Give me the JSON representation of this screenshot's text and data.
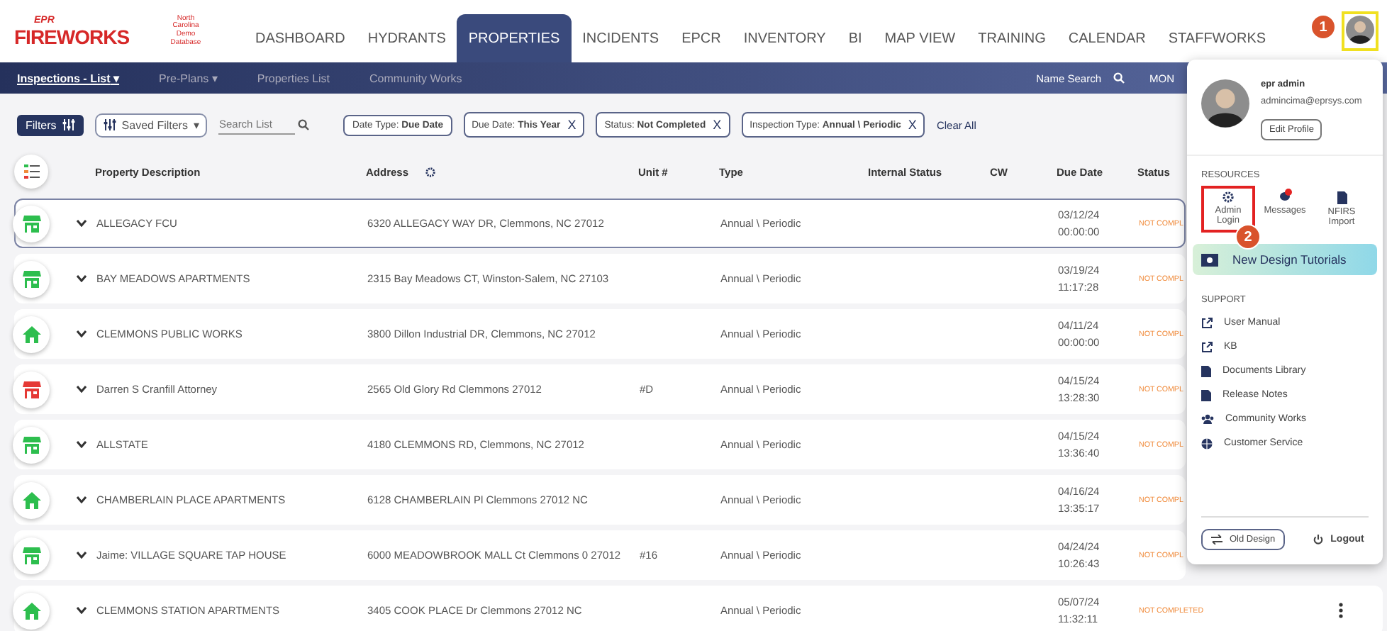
{
  "brand": {
    "logo_small": "EPR",
    "logo": "FIREWORKS",
    "database": "North Carolina Demo Database"
  },
  "main_nav": [
    {
      "label": "DASHBOARD",
      "selected": false
    },
    {
      "label": "HYDRANTS",
      "selected": false
    },
    {
      "label": "PROPERTIES",
      "selected": true
    },
    {
      "label": "INCIDENTS",
      "selected": false
    },
    {
      "label": "EPCR",
      "selected": false
    },
    {
      "label": "INVENTORY",
      "selected": false
    },
    {
      "label": "BI",
      "selected": false
    },
    {
      "label": "MAP VIEW",
      "selected": false
    },
    {
      "label": "TRAINING",
      "selected": false
    },
    {
      "label": "CALENDAR",
      "selected": false
    },
    {
      "label": "STAFFWORKS",
      "selected": false
    }
  ],
  "sub_nav": {
    "items": [
      {
        "label": "Inspections - List",
        "selected": true,
        "caret": "▾"
      },
      {
        "label": "Pre-Plans",
        "selected": false,
        "caret": "▾"
      },
      {
        "label": "Properties List",
        "selected": false
      },
      {
        "label": "Community Works",
        "selected": false
      }
    ],
    "name_search": "Name Search",
    "day": "MON"
  },
  "filters": {
    "button": "Filters",
    "saved": "Saved Filters",
    "saved_caret": "▾",
    "search_placeholder": "Search List",
    "chips": [
      {
        "name": "Date Type:",
        "value": "Due Date"
      },
      {
        "name": "Due Date:",
        "value": "This Year",
        "remove": "X"
      },
      {
        "name": "Status:",
        "value": "Not Completed",
        "remove": "X"
      },
      {
        "name": "Inspection Type:",
        "value": "Annual \\ Periodic",
        "remove": "X"
      }
    ],
    "clear": "Clear All"
  },
  "table": {
    "columns": [
      "Property Description",
      "Address",
      "Unit #",
      "Type",
      "Internal Status",
      "CW",
      "Due Date",
      "Status"
    ],
    "rows": [
      {
        "kind": "store",
        "color": "#2dbe4e",
        "selected": true,
        "description": "ALLEGACY FCU",
        "address": "6320 ALLEGACY WAY DR, Clemmons, NC 27012",
        "type": "Annual \\ Periodic",
        "date": "03/12/24",
        "time": "00:00:00",
        "status": "NOT COMPL"
      },
      {
        "kind": "store",
        "color": "#2dbe4e",
        "selected": false,
        "description": "BAY MEADOWS APARTMENTS",
        "address": "2315 Bay Meadows CT, Winston-Salem, NC 27103",
        "type": "Annual \\ Periodic",
        "date": "03/19/24",
        "time": "11:17:28",
        "status": "NOT COMPL"
      },
      {
        "kind": "home",
        "color": "#2dbe4e",
        "selected": false,
        "description": "CLEMMONS PUBLIC WORKS",
        "address": "3800 Dillon Industrial DR, Clemmons, NC 27012",
        "type": "Annual \\ Periodic",
        "date": "04/11/24",
        "time": "00:00:00",
        "status": "NOT COMPL"
      },
      {
        "kind": "store",
        "color": "#e53935",
        "selected": false,
        "description": "Darren S Cranfill Attorney",
        "address": "2565 Old Glory Rd Clemmons 27012",
        "unit": "#D",
        "type": "Annual \\ Periodic",
        "date": "04/15/24",
        "time": "13:28:30",
        "status": "NOT COMPL"
      },
      {
        "kind": "store",
        "color": "#2dbe4e",
        "selected": false,
        "description": "ALLSTATE",
        "address": "4180 CLEMMONS RD, Clemmons, NC 27012",
        "type": "Annual \\ Periodic",
        "date": "04/15/24",
        "time": "13:36:40",
        "status": "NOT COMPL"
      },
      {
        "kind": "home",
        "color": "#2dbe4e",
        "selected": false,
        "description": "CHAMBERLAIN PLACE APARTMENTS",
        "address": "6128 CHAMBERLAIN Pl Clemmons 27012 NC",
        "type": "Annual \\ Periodic",
        "date": "04/16/24",
        "time": "13:35:17",
        "status": "NOT COMPL"
      },
      {
        "kind": "store",
        "color": "#2dbe4e",
        "selected": false,
        "description": "Jaime: VILLAGE SQUARE TAP HOUSE",
        "address": "6000 MEADOWBROOK MALL Ct Clemmons 0 27012",
        "unit": "#16",
        "type": "Annual \\ Periodic",
        "date": "04/24/24",
        "time": "10:26:43",
        "status": "NOT COMPL"
      },
      {
        "kind": "home",
        "color": "#2dbe4e",
        "selected": false,
        "description": "CLEMMONS STATION APARTMENTS",
        "address": "3405 COOK PLACE Dr Clemmons 27012 NC",
        "type": "Annual \\ Periodic",
        "date": "05/07/24",
        "time": "11:32:11",
        "status": "NOT COMPLETED",
        "menu": true
      }
    ]
  },
  "user_menu": {
    "name": "epr admin",
    "email": "admincima@eprsys.com",
    "edit": "Edit Profile",
    "resources_title": "RESOURCES",
    "resources": [
      {
        "kind": "gear",
        "label": "Admin Login",
        "highlighted": true,
        "badge": false
      },
      {
        "kind": "chat",
        "label": "Messages",
        "highlighted": false,
        "badge": true
      },
      {
        "kind": "doc",
        "label": "NFIRS Import",
        "highlighted": false,
        "badge": false
      }
    ],
    "tutorials": "New Design Tutorials",
    "support_title": "SUPPORT",
    "support": [
      {
        "kind": "external",
        "label": "User Manual"
      },
      {
        "kind": "external",
        "label": "KB"
      },
      {
        "kind": "file",
        "label": "Documents Library"
      },
      {
        "kind": "file",
        "label": "Release Notes"
      },
      {
        "kind": "people",
        "label": "Community Works"
      },
      {
        "kind": "globe",
        "label": "Customer Service"
      }
    ],
    "old_design": "Old Design",
    "logout": "Logout"
  },
  "callouts": [
    "1",
    "2"
  ]
}
